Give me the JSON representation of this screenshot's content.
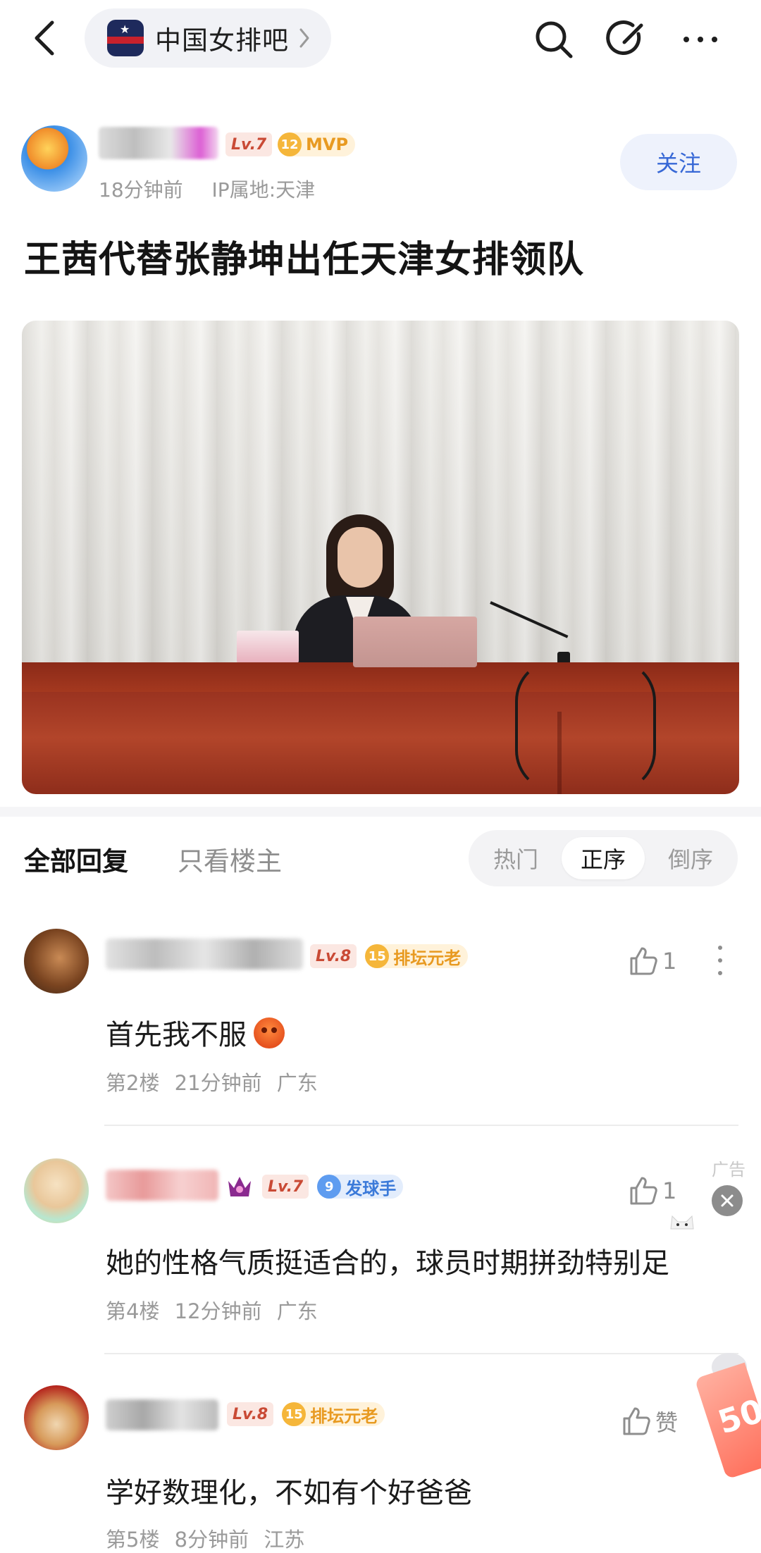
{
  "topbar": {
    "forum_name": "中国女排吧",
    "icons": [
      "back-icon",
      "search-icon",
      "edit-icon",
      "more-icon"
    ]
  },
  "post": {
    "author": {
      "level": "Lv.7",
      "honor_level": "12",
      "honor_title": "MVP",
      "time": "18分钟前",
      "ip": "IP属地:天津"
    },
    "follow_label": "关注",
    "title": "王茜代替张静坤出任天津女排领队"
  },
  "reply_bar": {
    "tab_all": "全部回复",
    "tab_owner": "只看楼主",
    "sort": [
      "热门",
      "正序",
      "倒序"
    ],
    "selected_sort": "正序"
  },
  "comments": [
    {
      "level": "Lv.8",
      "honor_level": "15",
      "honor_title": "排坛元老",
      "text": "首先我不服",
      "floor": "第2楼",
      "time": "21分钟前",
      "location": "广东",
      "likes": "1"
    },
    {
      "level": "Lv.7",
      "honor_level": "9",
      "honor_title": "发球手",
      "text": "她的性格气质挺适合的，球员时期拼劲特别足",
      "floor": "第4楼",
      "time": "12分钟前",
      "location": "广东",
      "likes": "1"
    },
    {
      "level": "Lv.8",
      "honor_level": "15",
      "honor_title": "排坛元老",
      "text": "学好数理化，不如有个好爸爸",
      "floor": "第5楼",
      "time": "8分钟前",
      "location": "江苏",
      "likes": "赞"
    }
  ],
  "ad": {
    "label": "广告",
    "coupon_text": "50"
  },
  "colors": {
    "accent": "#3768d6",
    "level_badge": "#c94a35",
    "honor_gold": "#e89a21",
    "honor_blue": "#3b7ad9"
  }
}
